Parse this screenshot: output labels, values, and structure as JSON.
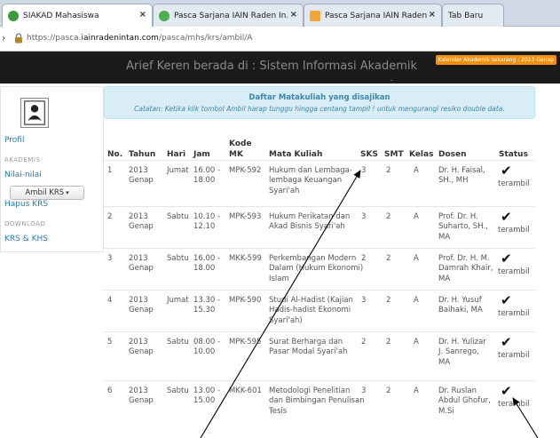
{
  "browser": {
    "tabs": [
      {
        "label": "SIAKAD Mahasiswa",
        "color": "#3c9a3c"
      },
      {
        "label": "Pasca Sarjana IAIN Raden In...",
        "color": "#4caf50"
      },
      {
        "label": "Pasca Sarjana IAIN Raden In...",
        "color": "#f3a53a"
      },
      {
        "label": "Tab Baru",
        "color": ""
      }
    ],
    "url_prefix": "https://pasca.",
    "url_domain": "iainradenintan.com",
    "url_path": "/pasca/mhs/krs/ambil/A"
  },
  "header": {
    "title": "Arief Keren berada di : Sistem Informasi Akademik",
    "badge": "Kalender Akademik sekarang : 2013 Genap"
  },
  "sidebar": {
    "profil": "Profil",
    "akademis_heading": "AKADEMIS",
    "nilai": "Nilai-nilai",
    "ambil_krs": "Ambil KRS",
    "hapus_krs": "Hapus KRS",
    "download_heading": "DOWNLOAD",
    "krs_khs": "KRS & KHS"
  },
  "info": {
    "heading": "Daftar Matakuliah yang disajikan",
    "note": "Catatan: Ketika klik tombol Ambil harap tunggu hingga centang tampil ! untuk mengurangi resiko double data."
  },
  "table": {
    "headers": {
      "no": "No.",
      "tahun": "Tahun",
      "hari": "Hari",
      "jam": "Jam",
      "kode": "Kode\nMK",
      "mata": "Mata Kuliah",
      "sks": "SKS",
      "smt": "SMT",
      "kelas": "Kelas",
      "dosen": "Dosen",
      "status": "Status"
    },
    "rows": [
      {
        "no": "1",
        "tahun": "2013\nGenap",
        "hari": "Jumat",
        "jam": "16.00 -\n18.00",
        "kode": "MPK-592",
        "mata": "Hukum dan Lembaga-\nlembaga Keuangan\nSyari'ah",
        "sks": "3",
        "smt": "2",
        "kelas": "A",
        "dosen": "Dr. H. Faisal,\nSH., MH",
        "status": "terambil"
      },
      {
        "no": "2",
        "tahun": "2013\nGenap",
        "hari": "Sabtu",
        "jam": "10.10 -\n12.10",
        "kode": "MPK-593",
        "mata": "Hukum Perikatan dan\nAkad Bisnis Syari'ah",
        "sks": "3",
        "smt": "2",
        "kelas": "A",
        "dosen": "Prof. Dr. H.\nSuharto, SH.,\nMA",
        "status": "terambil"
      },
      {
        "no": "3",
        "tahun": "2013\nGenap",
        "hari": "Sabtu",
        "jam": "16.00 -\n18.00",
        "kode": "MKK-599",
        "mata": "Perkembangan Modern\nDalam (Hukum Ekonomi)\nIslam",
        "sks": "2",
        "smt": "2",
        "kelas": "A",
        "dosen": "Prof. Dr. H. M.\nDamrah Khair,\nMA",
        "status": "terambil"
      },
      {
        "no": "4",
        "tahun": "2013\nGenap",
        "hari": "Jumat",
        "jam": "13.30 -\n15.30",
        "kode": "MPK-590",
        "mata": "Studi Al-Hadist (Kajian\nHadis-hadist Ekonomi\nSyari'ah)",
        "sks": "3",
        "smt": "2",
        "kelas": "A",
        "dosen": "Dr. H. Yusuf\nBaihaki, MA",
        "status": "terambil"
      },
      {
        "no": "5",
        "tahun": "2013\nGenap",
        "hari": "Sabtu",
        "jam": "08.00 -\n10.00",
        "kode": "MPK-595",
        "mata": "Surat Berharga dan\nPasar Modal Syari'ah",
        "sks": "2",
        "smt": "2",
        "kelas": "A",
        "dosen": "Dr. H. Yulizar\nJ. Sanrego,\nMA",
        "status": "terambil"
      },
      {
        "no": "6",
        "tahun": "2013\nGenap",
        "hari": "Sabtu",
        "jam": "13.00 -\n15.00",
        "kode": "MKK-601",
        "mata": "Metodologi Penelitian\ndan Bimbingan Penulisan\nTesis",
        "sks": "3",
        "smt": "2",
        "kelas": "A",
        "dosen": "Dr. Ruslan\nAbdul Ghofur,\nM.Si",
        "status": "terambil"
      }
    ]
  }
}
